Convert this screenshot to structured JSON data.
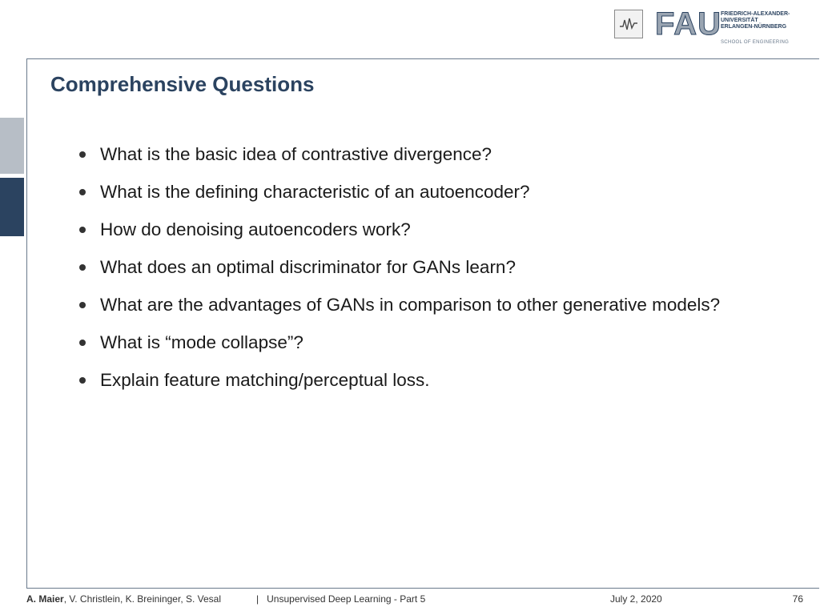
{
  "header": {
    "fau_wordmark": "FAU",
    "university_name": "FRIEDRICH-ALEXANDER-\nUNIVERSITÄT\nERLANGEN-NÜRNBERG",
    "school": "SCHOOL OF ENGINEERING"
  },
  "slide": {
    "title": "Comprehensive Questions",
    "questions": [
      "What is the basic idea of contrastive divergence?",
      "What is the defining characteristic of an autoencoder?",
      "How do denoising autoencoders work?",
      "What does an optimal discriminator for GANs learn?",
      "What are the advantages of GANs in comparison to other generative models?",
      "What is “mode collapse”?",
      "Explain feature matching/perceptual loss."
    ]
  },
  "footer": {
    "lead_author": "A. Maier",
    "coauthors": ", V. Christlein, K. Breininger, S. Vesal",
    "separator": "|",
    "course": "Unsupervised Deep Learning - Part 5",
    "date": "July 2, 2020",
    "page": "76"
  },
  "colors": {
    "accent": "#2b4360",
    "side_tab_light": "#b7bec6"
  }
}
